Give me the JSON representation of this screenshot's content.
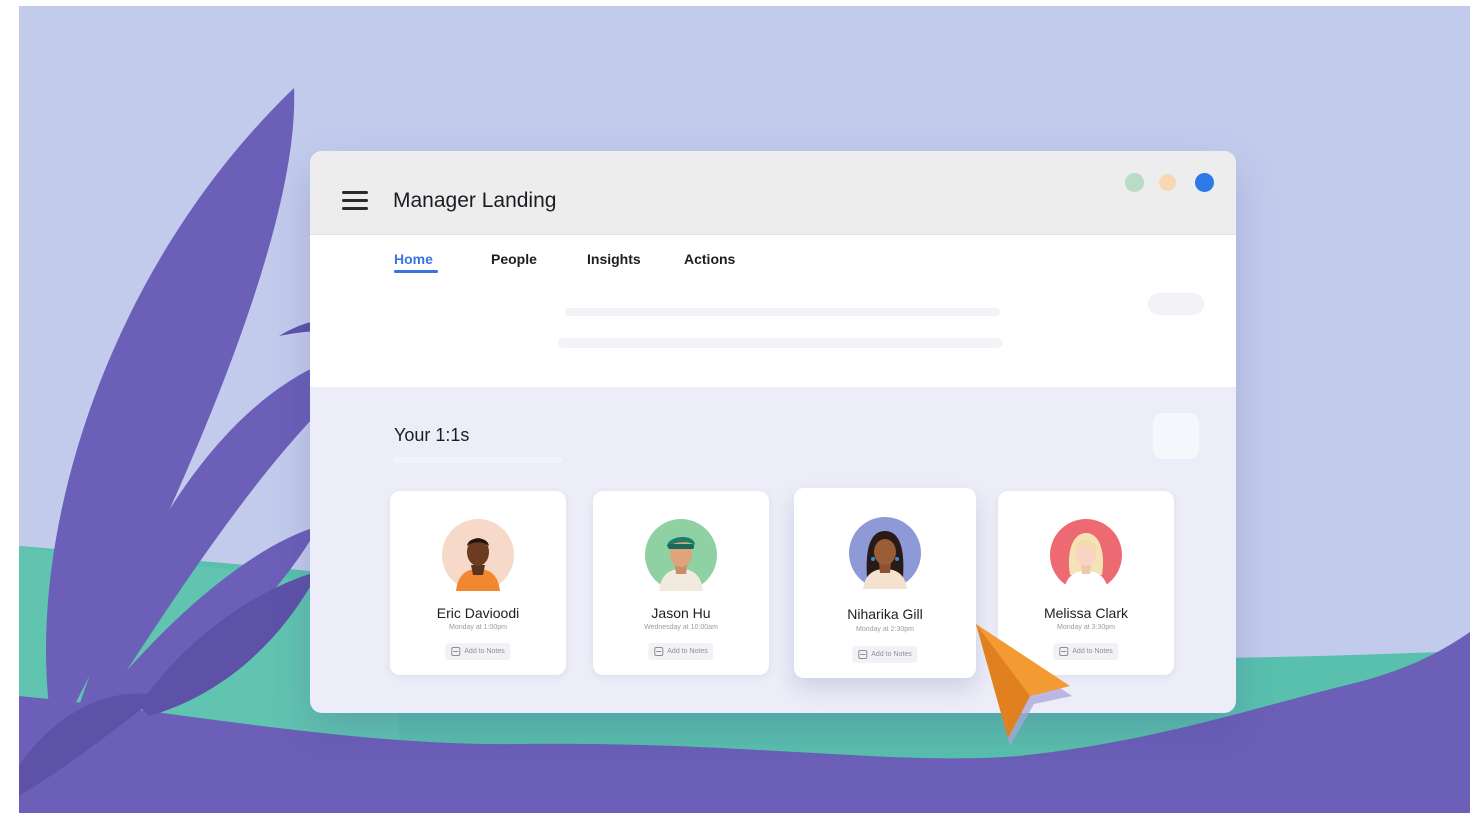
{
  "window": {
    "title": "Manager Landing"
  },
  "tabs": [
    {
      "label": "Home",
      "active": true
    },
    {
      "label": "People",
      "active": false
    },
    {
      "label": "Insights",
      "active": false
    },
    {
      "label": "Actions",
      "active": false
    }
  ],
  "section": {
    "title": "Your 1:1s"
  },
  "people": [
    {
      "name": "Eric Davioodi",
      "time": "Monday at 1:00pm",
      "action": "Add to Notes",
      "avatar_bg": "#f6d9c9"
    },
    {
      "name": "Jason Hu",
      "time": "Wednesday at 10:00am",
      "action": "Add to Notes",
      "avatar_bg": "#8fd1a2"
    },
    {
      "name": "Niharika Gill",
      "time": "Monday at 2:30pm",
      "action": "Add to Notes",
      "avatar_bg": "#8e9ad8"
    },
    {
      "name": "Melissa Clark",
      "time": "Monday at 3:30pm",
      "action": "Add to Notes",
      "avatar_bg": "#ee6a73"
    }
  ],
  "colors": {
    "accent": "#3a74df",
    "cursor": "#f39a32",
    "background": "#c3cbed",
    "foliage": "#6b5fb8",
    "sea": "#59c0ad"
  },
  "icons": [
    "menu-icon",
    "notes-icon",
    "pointer-cursor-icon"
  ]
}
